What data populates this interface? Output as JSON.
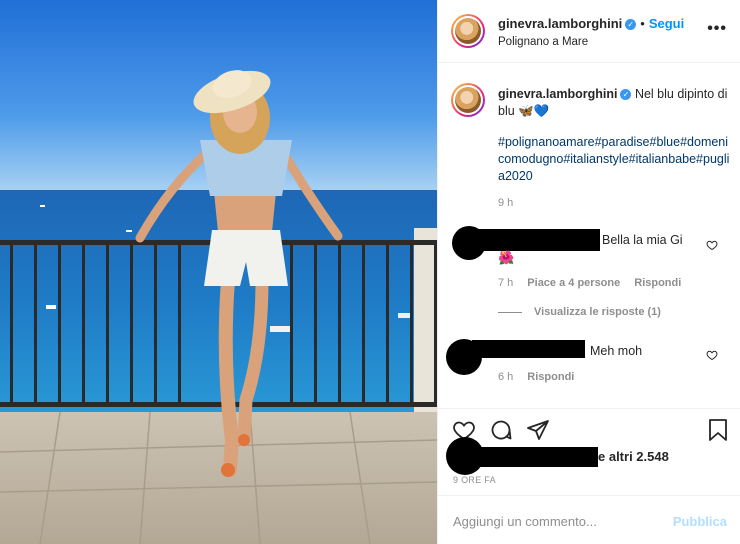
{
  "post": {
    "username": "ginevra.lamborghini",
    "follow_label": "Segui",
    "separator": "•",
    "location": "Polignano a Mare",
    "more_icon": "more-icon",
    "verified_icon": "verified-badge-icon"
  },
  "caption": {
    "username": "ginevra.lamborghini",
    "text": "Nel blu dipinto di blu 🦋💙",
    "hashtags": "#polignanoamare#paradise#blue#domenicomodugno#italianstyle#italianbabe#puglia2020",
    "time": "9 h"
  },
  "comments": [
    {
      "text": "Bella la mia Gi",
      "emoji": "🌺",
      "time": "7 h",
      "likes": "Piace a 4 persone",
      "reply_label": "Rispondi",
      "view_replies": "Visualizza le risposte (1)"
    },
    {
      "text": "Meh moh",
      "time": "6 h",
      "reply_label": "Rispondi"
    }
  ],
  "actions": {
    "likes_text": "e altri 2.548",
    "post_time": "9 ORE FA",
    "icons": [
      "heart-icon",
      "comment-icon",
      "share-icon",
      "bookmark-icon"
    ]
  },
  "add_comment": {
    "placeholder": "Aggiungi un commento...",
    "publish_label": "Pubblica"
  },
  "colors": {
    "link_blue": "#0095f6",
    "hashtag": "#00376b",
    "muted": "#8e8e8e",
    "publish_disabled": "#b2dffc"
  }
}
